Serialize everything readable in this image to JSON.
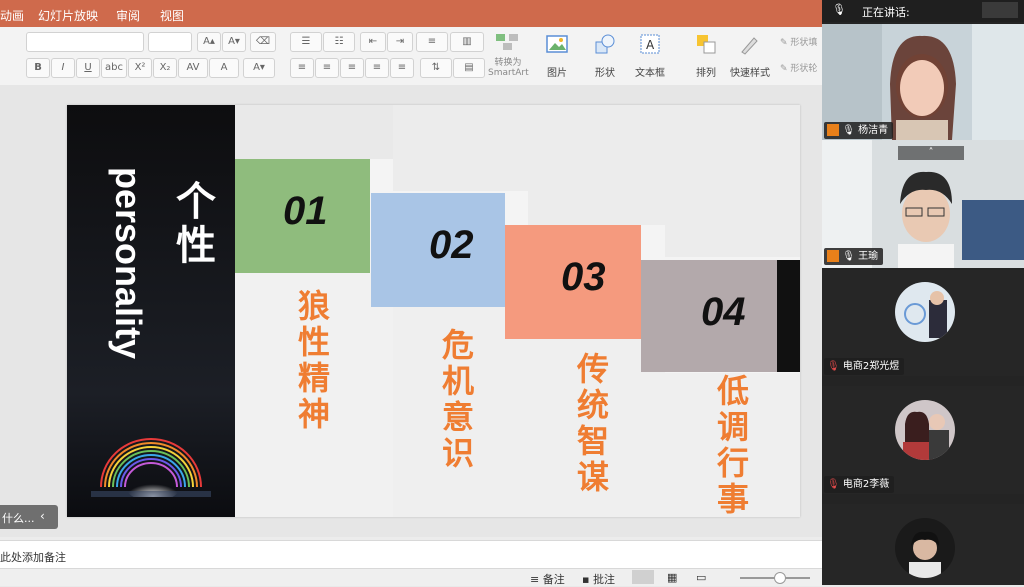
{
  "menubar": {
    "items": [
      "动画",
      "幻灯片放映",
      "审阅",
      "视图"
    ]
  },
  "ribbon": {
    "format_buttons": [
      "B",
      "I",
      "U",
      "abc",
      "X²",
      "X₂"
    ],
    "smartart_label": "转换为\nSmartArt",
    "large_buttons": [
      "图片",
      "形状",
      "文本框",
      "排列",
      "快速样式"
    ],
    "shape_fill_label": "形状填",
    "shape_outline_label": "形状轮"
  },
  "slide": {
    "side_title_en": "personality",
    "side_title_cn": "个\n性",
    "items": [
      {
        "number": "01",
        "label": "狼\n性\n精\n神",
        "color": "#8fbc7d"
      },
      {
        "number": "02",
        "label": "危\n机\n意\n识",
        "color": "#a9c5e6"
      },
      {
        "number": "03",
        "label": "传\n统\n智\n谋",
        "color": "#f59a7e"
      },
      {
        "number": "04",
        "label": "低\n调\n行\n事",
        "color": "#b3a9ab"
      }
    ]
  },
  "left_panel_button": "什么...",
  "notes_placeholder": "此处添加备注",
  "statusbar": {
    "notes_label": "备注",
    "comments_label": "批注"
  },
  "meeting": {
    "speaking_label": "正在讲话:",
    "participants": [
      {
        "name": "杨洁青",
        "video": true
      },
      {
        "name": "王瑜",
        "video": true
      },
      {
        "name": "电商2郑光煜",
        "video": false
      },
      {
        "name": "电商2李薇",
        "video": false
      },
      {
        "name": "",
        "video": false
      }
    ]
  }
}
